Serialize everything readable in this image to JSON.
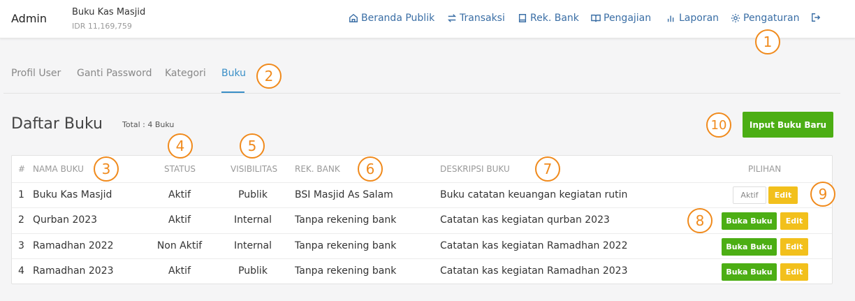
{
  "header": {
    "brand": "Admin",
    "book_title": "Buku Kas Masjid",
    "book_balance": "IDR 11,169,759",
    "nav": [
      {
        "label": "Beranda Publik",
        "icon": "home-icon"
      },
      {
        "label": "Transaksi",
        "icon": "transfer-icon"
      },
      {
        "label": "Rek. Bank",
        "icon": "book-icon"
      },
      {
        "label": "Pengajian",
        "icon": "open-book-icon"
      },
      {
        "label": "Laporan",
        "icon": "bar-chart-icon"
      },
      {
        "label": "Pengaturan",
        "icon": "gear-icon"
      }
    ],
    "logout_icon": "logout-icon"
  },
  "tabs": [
    {
      "label": "Profil User",
      "active": false
    },
    {
      "label": "Ganti Password",
      "active": false
    },
    {
      "label": "Kategori",
      "active": false
    },
    {
      "label": "Buku",
      "active": true
    }
  ],
  "main": {
    "title": "Daftar Buku",
    "total": "Total : 4 Buku",
    "add_button": "Input Buku Baru"
  },
  "table": {
    "headers": [
      "#",
      "NAMA BUKU",
      "STATUS",
      "VISIBILITAS",
      "REK. BANK",
      "DESKRIPSI BUKU",
      "PILIHAN"
    ],
    "rows": [
      {
        "no": "1",
        "name": "Buku Kas Masjid",
        "status": "Aktif",
        "visibility": "Publik",
        "bank": "BSI Masjid As Salam",
        "description": "Buku catatan keuangan kegiatan rutin",
        "action_primary": "Aktif",
        "action_edit": "Edit"
      },
      {
        "no": "2",
        "name": "Qurban 2023",
        "status": "Aktif",
        "visibility": "Internal",
        "bank": "Tanpa rekening bank",
        "description": "Catatan kas kegiatan qurban 2023",
        "action_primary": "Buka Buku",
        "action_edit": "Edit"
      },
      {
        "no": "3",
        "name": "Ramadhan 2022",
        "status": "Non Aktif",
        "visibility": "Internal",
        "bank": "Tanpa rekening bank",
        "description": "Catatan kas kegiatan Ramadhan 2022",
        "action_primary": "Buka Buku",
        "action_edit": "Edit"
      },
      {
        "no": "4",
        "name": "Ramadhan 2023",
        "status": "Aktif",
        "visibility": "Publik",
        "bank": "Tanpa rekening bank",
        "description": "Catatan kas kegiatan Ramadhan 2023",
        "action_primary": "Buka Buku",
        "action_edit": "Edit"
      }
    ]
  },
  "markers": [
    "1",
    "2",
    "3",
    "4",
    "5",
    "6",
    "7",
    "8",
    "9",
    "10"
  ],
  "colors": {
    "accent": "#3a8fc7",
    "link": "#3a6ea5",
    "success": "#4cae14",
    "warning": "#f2c01c",
    "marker": "#f08a1c"
  }
}
